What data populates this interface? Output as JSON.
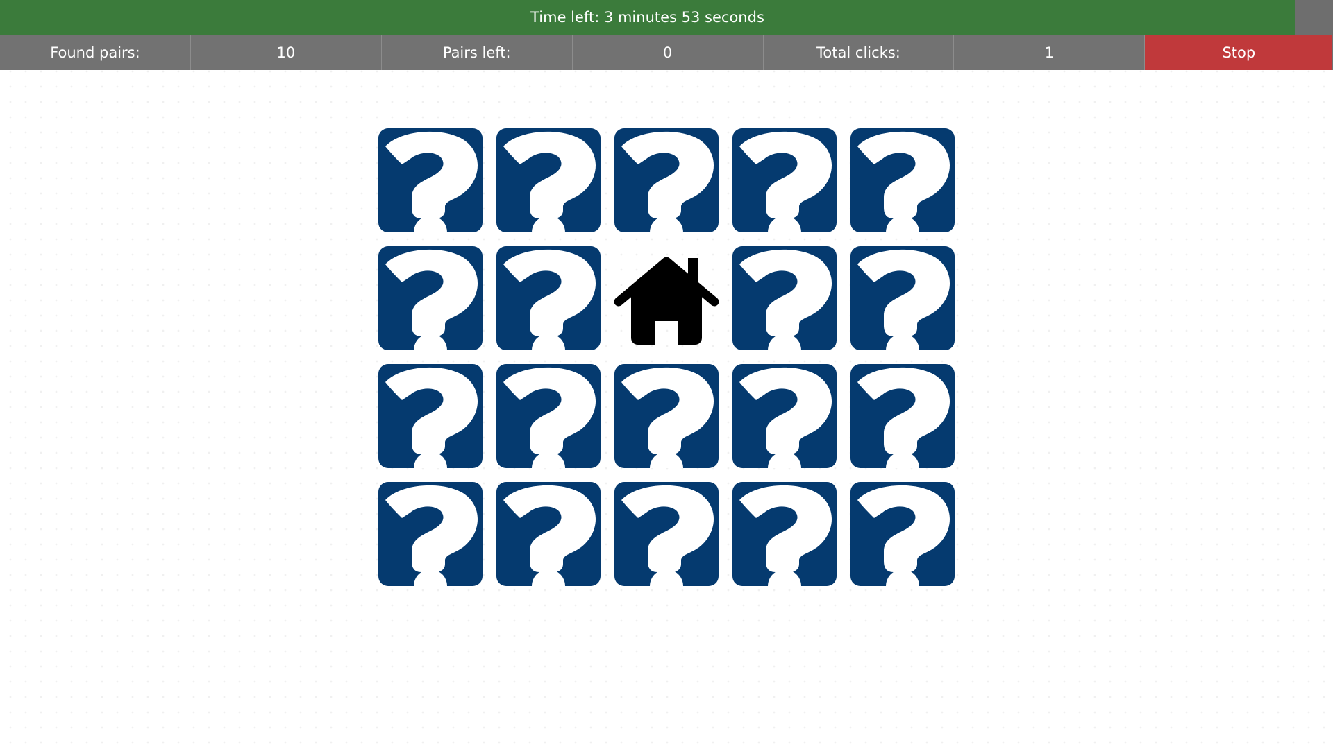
{
  "header": {
    "time_left": "Time left: 3 minutes 53 seconds"
  },
  "stats": {
    "found_pairs_label": "Found pairs:",
    "found_pairs_value": "10",
    "pairs_left_label": "Pairs left:",
    "pairs_left_value": "0",
    "total_clicks_label": "Total clicks:",
    "total_clicks_value": "1",
    "stop_label": "Stop"
  },
  "board": {
    "rows": 4,
    "columns": 5,
    "cards": [
      "question-icon",
      "question-icon",
      "question-icon",
      "question-icon",
      "question-icon",
      "question-icon",
      "question-icon",
      "home-icon",
      "question-icon",
      "question-icon",
      "question-icon",
      "question-icon",
      "question-icon",
      "question-icon",
      "question-icon",
      "question-icon",
      "question-icon",
      "question-icon",
      "question-icon",
      "question-icon"
    ]
  },
  "colors": {
    "timer_bar": "#3b7b3b",
    "stats_bar": "#727272",
    "stop_button": "#c0393b",
    "card_back": "#053a6f"
  }
}
